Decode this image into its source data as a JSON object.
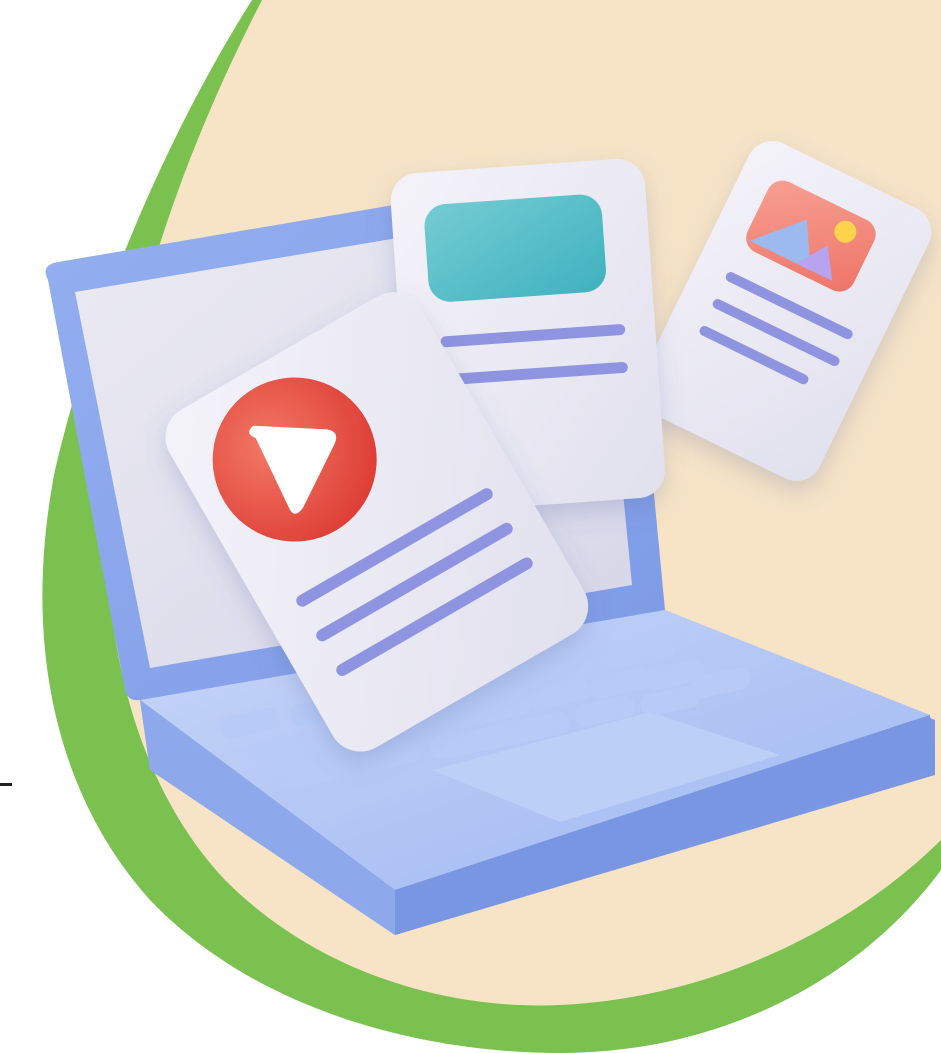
{
  "colors": {
    "background": "#ffffff",
    "accent_green": "#7bc14f",
    "cream": "#f7e4c6",
    "laptop_blue": "#8aa8ee",
    "laptop_light": "#b8cdf6",
    "screen": "#e4e2ee",
    "card": "#ecebf4",
    "line_purple": "#8e94e0",
    "play_red": "#e5473f",
    "teal": "#4dbdc7",
    "photo_coral": "#f38b80",
    "photo_yellow": "#fbd34d",
    "photo_blue": "#9cb9f0",
    "photo_purple": "#b7a3ef"
  },
  "icons": {
    "video_document": "play-icon",
    "image_document": "image-icon",
    "web_document": "banner-block"
  }
}
